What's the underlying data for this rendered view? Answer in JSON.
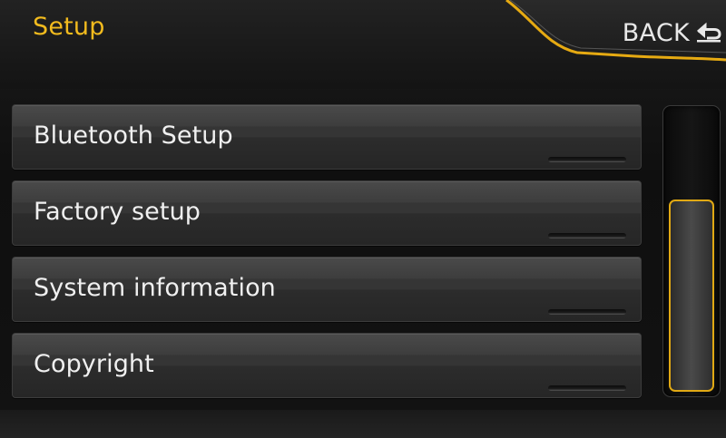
{
  "header": {
    "title": "Setup",
    "back_label": "BACK",
    "back_icon": "return-arrow-icon",
    "accent_color": "#f2bb1e"
  },
  "menu": {
    "items": [
      {
        "label": "Bluetooth Setup"
      },
      {
        "label": "Factory setup"
      },
      {
        "label": "System information"
      },
      {
        "label": "Copyright"
      }
    ]
  },
  "scrollbar": {
    "position_fraction": 0.33,
    "thumb_color": "#e1a914"
  }
}
